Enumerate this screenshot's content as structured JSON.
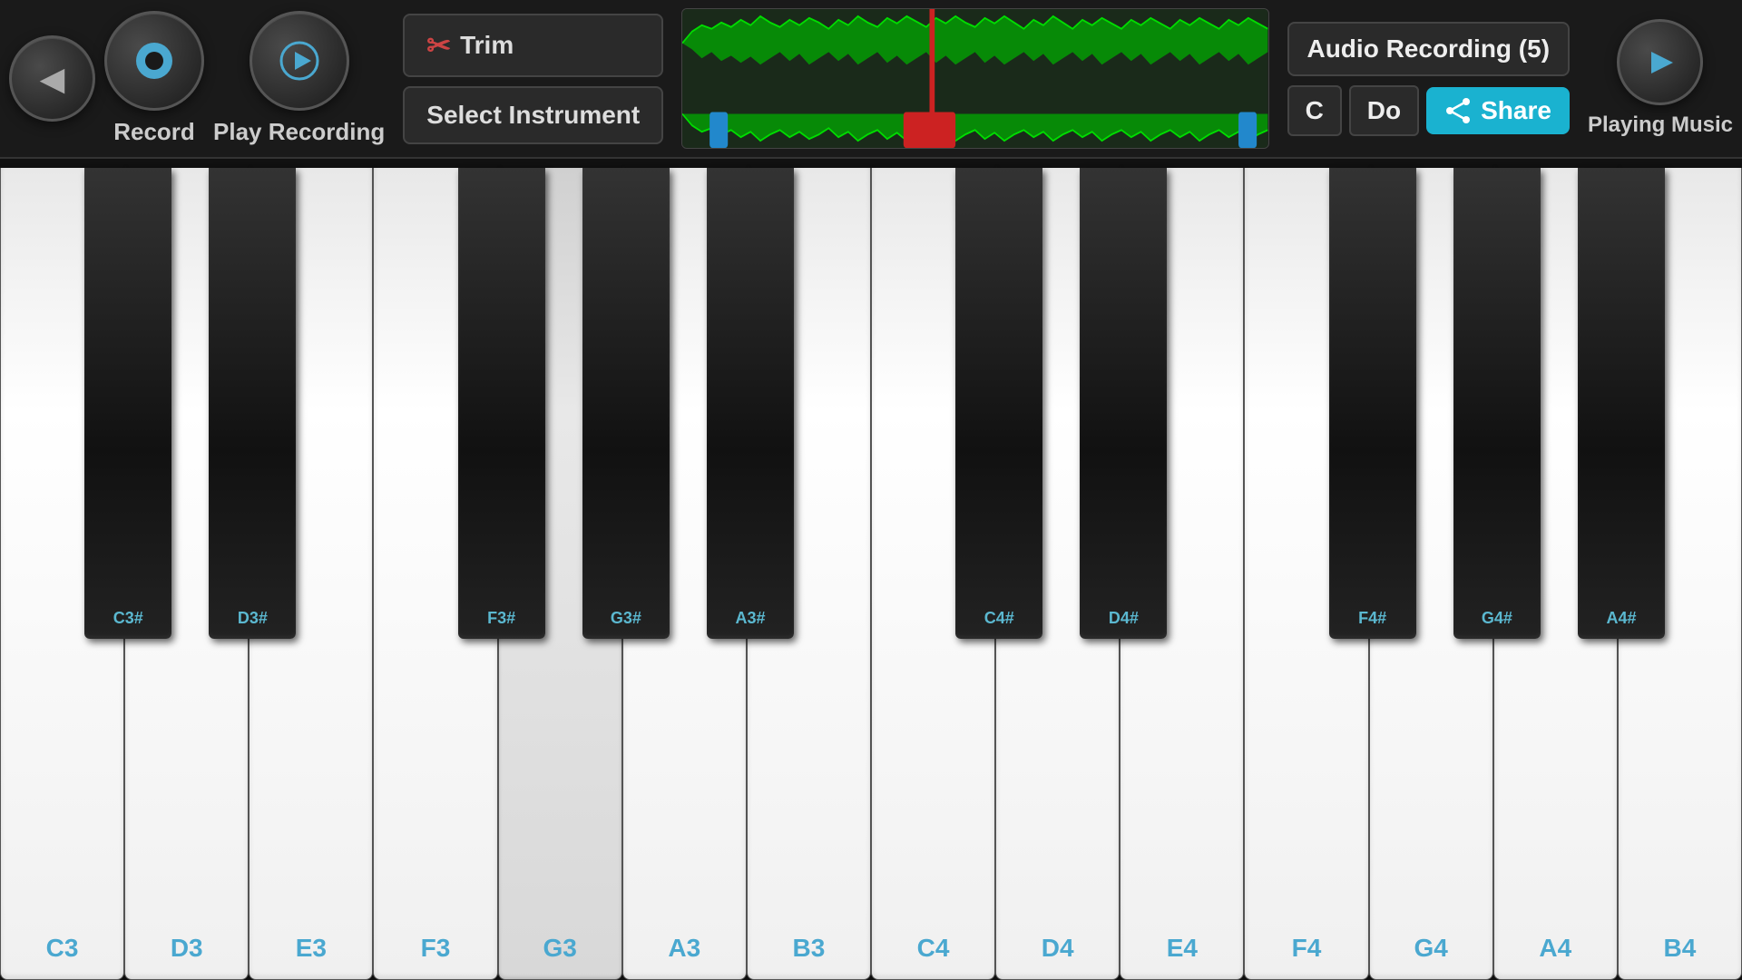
{
  "toolbar": {
    "back_icon": "◀",
    "record_label": "Record",
    "play_recording_label": "Play Recording",
    "trim_label": "Trim",
    "select_instrument_label": "Select Instrument",
    "audio_recording_title": "Audio Recording (5)",
    "note_key": "C",
    "solfege": "Do",
    "share_label": "Share",
    "playing_music_label": "Playing Music"
  },
  "piano": {
    "white_keys": [
      {
        "note": "C3",
        "active": false
      },
      {
        "note": "D3",
        "active": false
      },
      {
        "note": "E3",
        "active": false
      },
      {
        "note": "F3",
        "active": false
      },
      {
        "note": "G3",
        "active": true
      },
      {
        "note": "A3",
        "active": false
      },
      {
        "note": "B3",
        "active": false
      },
      {
        "note": "C4",
        "active": false
      },
      {
        "note": "D4",
        "active": false
      },
      {
        "note": "E4",
        "active": false
      },
      {
        "note": "F4",
        "active": false
      },
      {
        "note": "G4",
        "active": false
      },
      {
        "note": "A4",
        "active": false
      },
      {
        "note": "B4",
        "active": false
      }
    ],
    "black_keys": [
      {
        "note": "C3#",
        "position_index": 0
      },
      {
        "note": "D3#",
        "position_index": 1
      },
      {
        "note": "F3#",
        "position_index": 3
      },
      {
        "note": "G3#",
        "position_index": 4
      },
      {
        "note": "A3#",
        "position_index": 5
      },
      {
        "note": "C4#",
        "position_index": 7
      },
      {
        "note": "D4#",
        "position_index": 8
      },
      {
        "note": "F4#",
        "position_index": 10
      },
      {
        "note": "G4#",
        "position_index": 11
      },
      {
        "note": "A4#",
        "position_index": 12
      }
    ]
  }
}
